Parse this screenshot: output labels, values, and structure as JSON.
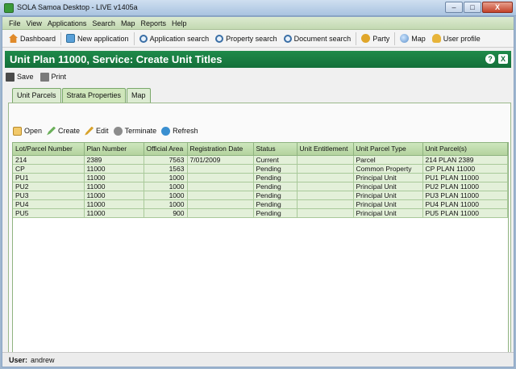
{
  "window": {
    "title": "SOLA Samoa Desktop - LIVE v1405a",
    "minimize": "–",
    "maximize": "□",
    "close": "X"
  },
  "menu": [
    "File",
    "View",
    "Applications",
    "Search",
    "Map",
    "Reports",
    "Help"
  ],
  "toolbar": {
    "dashboard": "Dashboard",
    "new_application": "New application",
    "application_search": "Application search",
    "property_search": "Property search",
    "document_search": "Document search",
    "party": "Party",
    "map": "Map",
    "user_profile": "User profile"
  },
  "header": {
    "title": "Unit Plan 11000, Service: Create Unit Titles",
    "help": "?",
    "close": "X"
  },
  "form_actions": {
    "save": "Save",
    "print": "Print"
  },
  "tabs": [
    "Unit Parcels",
    "Strata Properties",
    "Map"
  ],
  "active_tab": 1,
  "grid_actions": {
    "open": "Open",
    "create": "Create",
    "edit": "Edit",
    "terminate": "Terminate",
    "refresh": "Refresh"
  },
  "table": {
    "columns": [
      "Lot/Parcel Number",
      "Plan Number",
      "Official Area",
      "Registration Date",
      "Status",
      "Unit Entitlement",
      "Unit Parcel Type",
      "Unit Parcel(s)"
    ],
    "rows": [
      [
        "214",
        "2389",
        "7563",
        "7/01/2009",
        "Current",
        "",
        "Parcel",
        "214 PLAN 2389"
      ],
      [
        "CP",
        "11000",
        "1563",
        "",
        "Pending",
        "",
        "Common Property",
        "CP PLAN 11000"
      ],
      [
        "PU1",
        "11000",
        "1000",
        "",
        "Pending",
        "",
        "Principal Unit",
        "PU1 PLAN 11000"
      ],
      [
        "PU2",
        "11000",
        "1000",
        "",
        "Pending",
        "",
        "Principal Unit",
        "PU2 PLAN 11000"
      ],
      [
        "PU3",
        "11000",
        "1000",
        "",
        "Pending",
        "",
        "Principal Unit",
        "PU3 PLAN 11000"
      ],
      [
        "PU4",
        "11000",
        "1000",
        "",
        "Pending",
        "",
        "Principal Unit",
        "PU4 PLAN 11000"
      ],
      [
        "PU5",
        "11000",
        "900",
        "",
        "Pending",
        "",
        "Principal Unit",
        "PU5 PLAN 11000"
      ]
    ]
  },
  "status": {
    "user_label": "User:",
    "user_name": "andrew"
  }
}
